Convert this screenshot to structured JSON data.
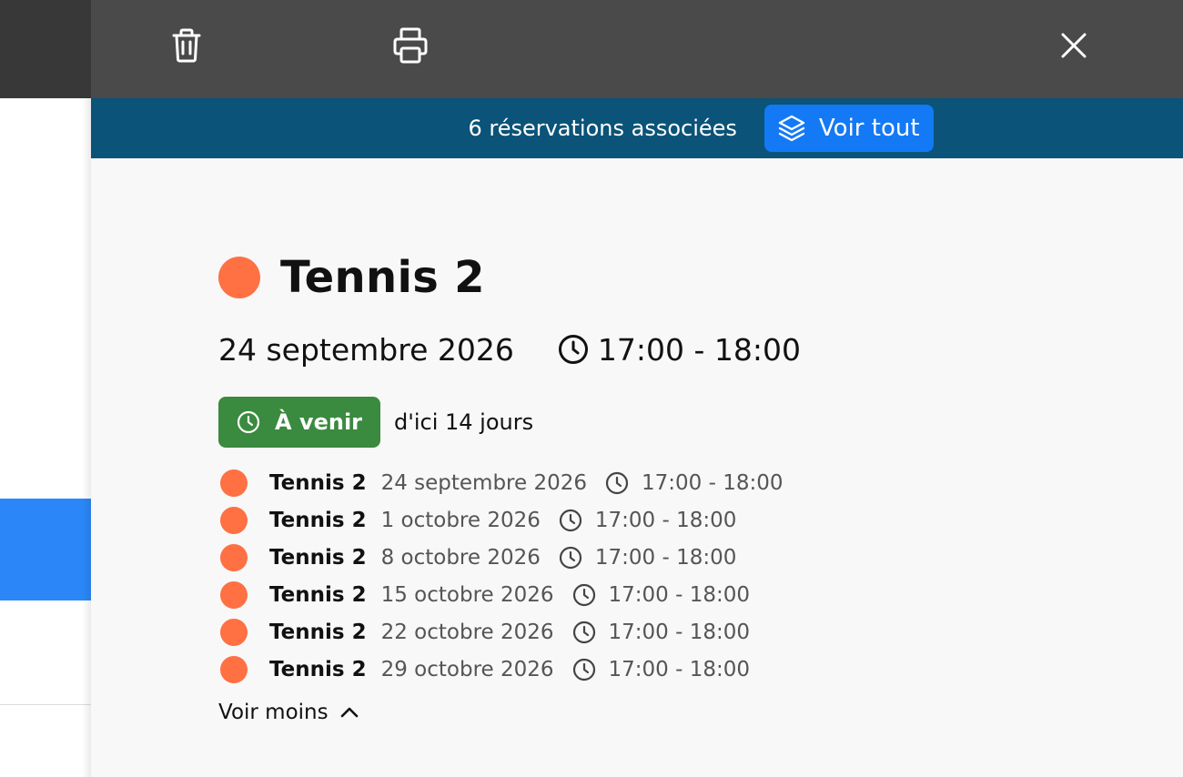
{
  "toolbar": {
    "delete_icon": "trash-icon",
    "print_icon": "printer-icon",
    "close_icon": "close-icon",
    "background": "#4a4a4a"
  },
  "banner": {
    "text": "6 réservations associées",
    "button_label": "Voir tout",
    "button_icon": "layers-icon",
    "background": "#0b5378",
    "button_color": "#1479f5"
  },
  "booking": {
    "title": "Tennis 2",
    "color": "#ff7043",
    "date": "24 septembre 2026",
    "time": "17:00 - 18:00",
    "status_label": "À venir",
    "status_color": "#3a8a3f",
    "status_relative": "d'ici 14 jours"
  },
  "occurrences": [
    {
      "name": "Tennis 2",
      "date": "24 septembre 2026",
      "time": "17:00 - 18:00"
    },
    {
      "name": "Tennis 2",
      "date": "1 octobre 2026",
      "time": "17:00 - 18:00"
    },
    {
      "name": "Tennis 2",
      "date": "8 octobre 2026",
      "time": "17:00 - 18:00"
    },
    {
      "name": "Tennis 2",
      "date": "15 octobre 2026",
      "time": "17:00 - 18:00"
    },
    {
      "name": "Tennis 2",
      "date": "22 octobre 2026",
      "time": "17:00 - 18:00"
    },
    {
      "name": "Tennis 2",
      "date": "29 octobre 2026",
      "time": "17:00 - 18:00"
    }
  ],
  "toggle": {
    "label": "Voir moins",
    "icon": "chevron-up-icon"
  }
}
